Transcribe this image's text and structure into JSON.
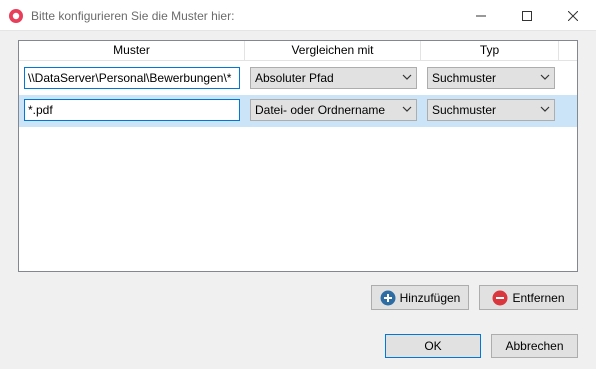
{
  "window": {
    "title": "Bitte konfigurieren Sie die Muster hier:",
    "app_icon": "app-logo-icon",
    "controls": [
      "minimize-icon",
      "maximize-icon",
      "close-icon"
    ]
  },
  "grid": {
    "columns": [
      "Muster",
      "Vergleichen mit",
      "Typ"
    ],
    "rows": [
      {
        "muster": "\\\\DataServer\\Personal\\Bewerbungen\\*",
        "vergleichen_mit": "Absoluter Pfad",
        "typ": "Suchmuster",
        "selected": false
      },
      {
        "muster": "*.pdf",
        "vergleichen_mit": "Datei- oder Ordnername",
        "typ": "Suchmuster",
        "selected": true
      }
    ]
  },
  "buttons": {
    "add": "Hinzufügen",
    "remove": "Entfernen",
    "ok": "OK",
    "cancel": "Abbrechen"
  },
  "colors": {
    "accent": "#0078d7",
    "selected_row": "#cce4f7",
    "add_icon": "#2e6da4",
    "remove_icon": "#d9363e",
    "app_icon": "#e83e5a"
  }
}
